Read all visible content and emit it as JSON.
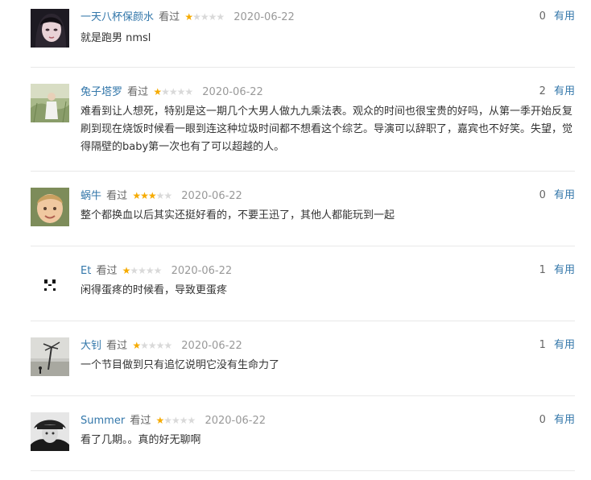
{
  "status_label": "看过",
  "useful_label": "有用",
  "comments": [
    {
      "username": "一天八杯保颜水",
      "rating": 1,
      "date": "2020-06-22",
      "votes": "0",
      "text": "就是跑男 nmsl",
      "avatar": "girl-portrait-avatar"
    },
    {
      "username": "兔子塔罗",
      "rating": 1,
      "date": "2020-06-22",
      "votes": "2",
      "text": "难看到让人想死，特别是这一期几个大男人做九九乘法表。观众的时间也很宝贵的好吗，从第一季开始反复刷到现在烧饭时候看一眼到连这种垃圾时间都不想看这个综艺。导演可以辞职了，嘉宾也不好笑。失望，觉得隔壁的baby第一次也有了可以超越的人。",
      "avatar": "field-girl-avatar"
    },
    {
      "username": "蜗牛",
      "rating": 3,
      "date": "2020-06-22",
      "votes": "0",
      "text": "整个都换血以后其实还挺好看的，不要王迅了，其他人都能玩到一起",
      "avatar": "child-face-avatar"
    },
    {
      "username": "Et",
      "rating": 1,
      "date": "2020-06-22",
      "votes": "1",
      "text": "闲得蛋疼的时候看，导致更蛋疼",
      "avatar": "panda-face-avatar"
    },
    {
      "username": "大钊",
      "rating": 1,
      "date": "2020-06-22",
      "votes": "1",
      "text": "一个节目做到只有追忆说明它没有生命力了",
      "avatar": "beach-tree-avatar"
    },
    {
      "username": "Summer",
      "rating": 1,
      "date": "2020-06-22",
      "votes": "0",
      "text": "看了几期。。真的好无聊啊",
      "avatar": "hat-woman-avatar"
    }
  ]
}
